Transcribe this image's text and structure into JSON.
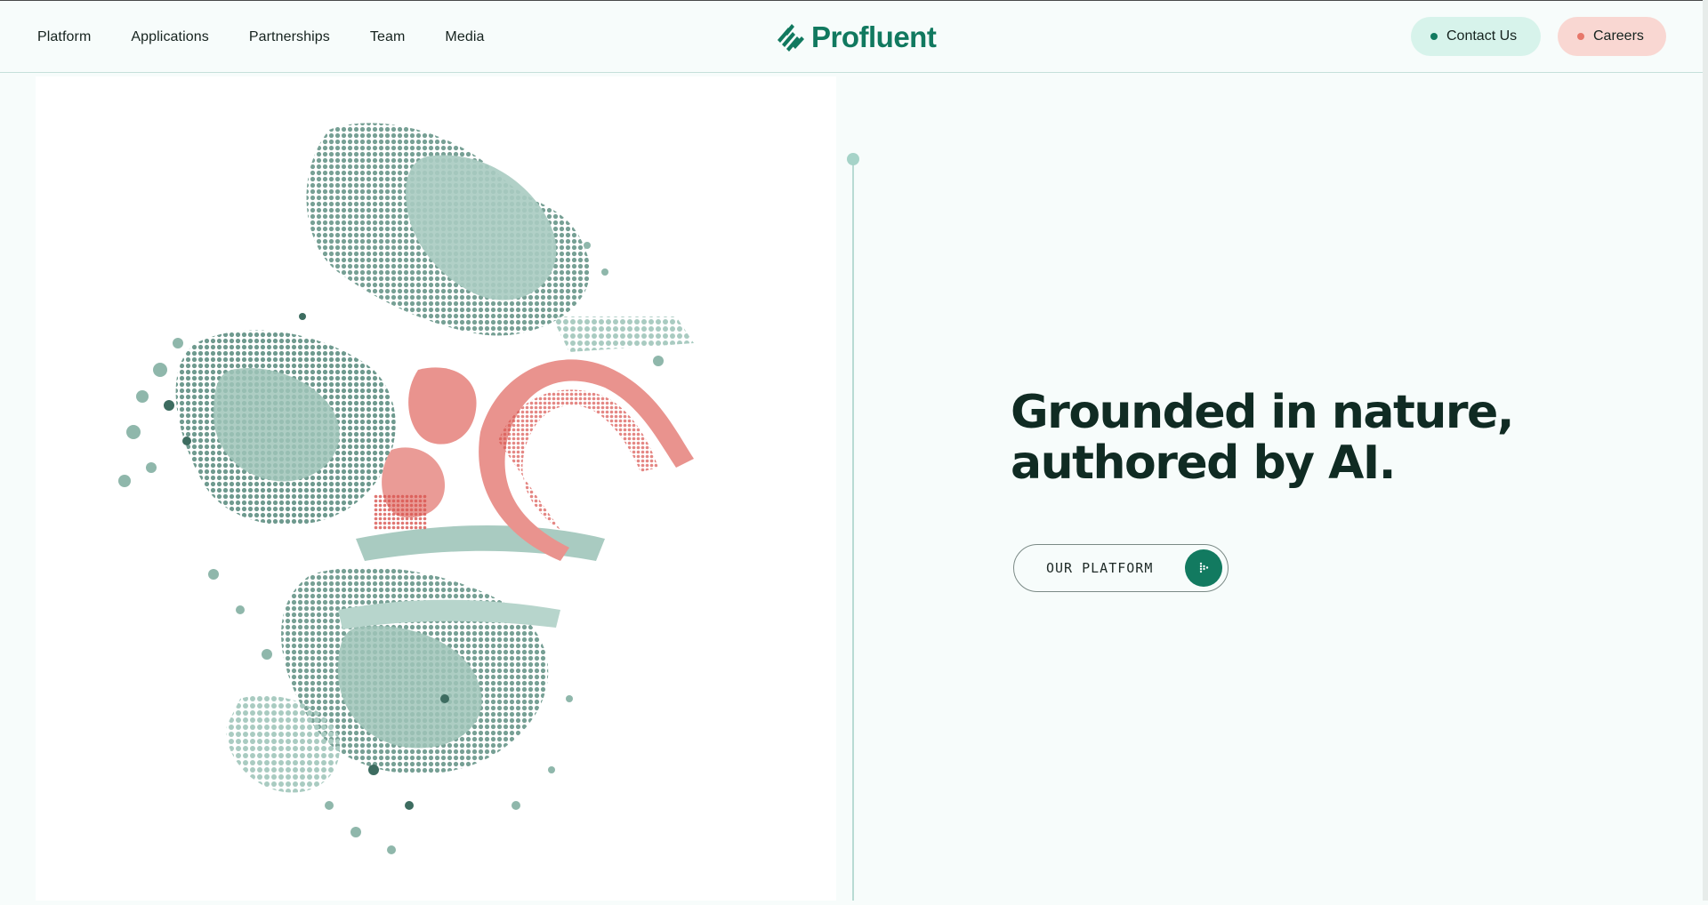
{
  "nav": {
    "items": [
      {
        "label": "Platform"
      },
      {
        "label": "Applications"
      },
      {
        "label": "Partnerships"
      },
      {
        "label": "Team"
      },
      {
        "label": "Media"
      }
    ]
  },
  "brand": {
    "name": "Profluent",
    "logo_icon": "striped-diamond-logo",
    "color": "#11795f"
  },
  "actions": {
    "contact": {
      "label": "Contact Us",
      "dot_color": "#127a60",
      "bg": "#d7f3eb"
    },
    "careers": {
      "label": "Careers",
      "dot_color": "#e7776a",
      "bg": "#f9d7d2"
    }
  },
  "hero": {
    "headline_line1": "Grounded in nature,",
    "headline_line2": "authored by AI.",
    "cta_label": "OUR PLATFORM",
    "cta_icon": "dotted-arrow-icon",
    "art": "protein-dna-dot-matrix-illustration",
    "colors": {
      "protein": "#9fc4b9",
      "protein_dark": "#4f8072",
      "dna": "#e98f8a",
      "dna_dark": "#d0514c"
    }
  }
}
